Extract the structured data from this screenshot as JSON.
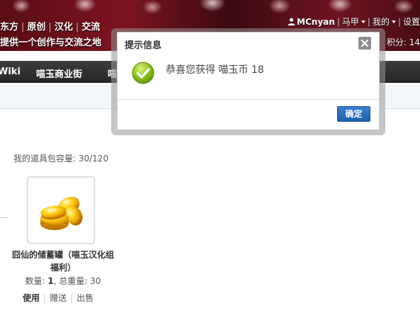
{
  "header": {
    "site_nav": [
      "东方",
      "原创",
      "汉化",
      "交流"
    ],
    "slogan": "提供一个创作与交流之地",
    "user": {
      "username": "MCnyan",
      "group": "马甲",
      "my_menu": "我的",
      "settings": "设置",
      "points": "积分: 14"
    }
  },
  "mainnav": {
    "items": [
      "Wiki",
      "喵玉商业街",
      "喵"
    ]
  },
  "content": {
    "bag_capacity": "我的道具包容量: 30/120",
    "item": {
      "name": "囧仙的储蓄罐（喵玉汉化组福利）",
      "qty_label": "数量: ",
      "qty_value": "1",
      "weight_label": ", 总重量: 30",
      "actions": {
        "use": "使用",
        "gift": "赠送",
        "sell": "出售"
      }
    }
  },
  "modal": {
    "title": "提示信息",
    "message": "恭喜您获得 喵玉币 18",
    "ok_label": "确定",
    "icon": "success-check-icon"
  },
  "colors": {
    "nav_bg": "#2e2e2e",
    "banner_bg": "#6e1420",
    "ok_button": "#2a6dc0",
    "success_green": "#8cc21a"
  }
}
